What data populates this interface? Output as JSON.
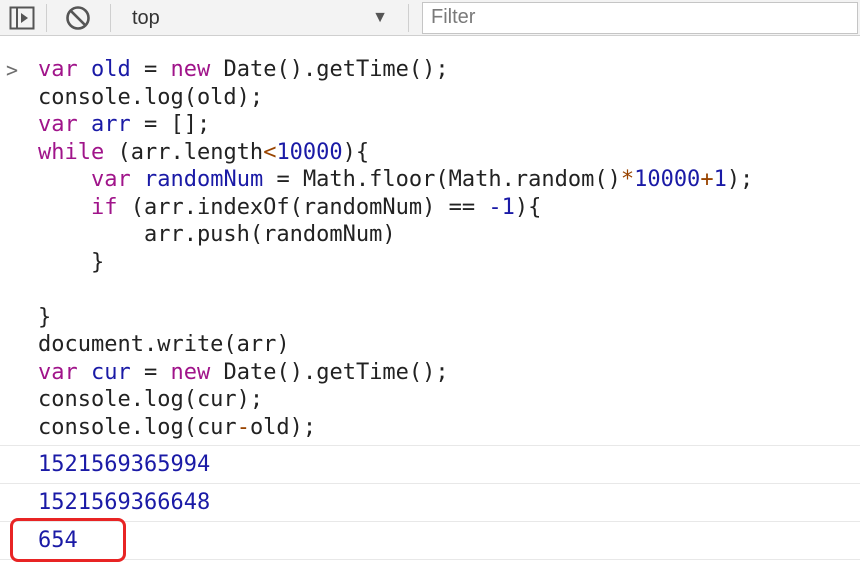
{
  "toolbar": {
    "context_value": "top",
    "filter_placeholder": "Filter",
    "icons": [
      "sidebar-toggle-icon",
      "clear-console-icon",
      "chevron-down-icon"
    ]
  },
  "console": {
    "prompt_symbol": ">",
    "code": {
      "l1": {
        "kw": "var",
        "var": "old",
        "eq": " = ",
        "kw2": "new",
        "rest": " Date().getTime();"
      },
      "l2": "console.log(old);",
      "l3": {
        "kw": "var",
        "var": "arr",
        "rest": " = [];"
      },
      "l4": {
        "kw": "while",
        "a": " (arr.length",
        "op": "<",
        "num": "10000",
        "b": "){"
      },
      "l5": {
        "indent": "    ",
        "kw": "var",
        "var": "randomNum",
        "a": " = Math.floor(Math.random()",
        "op": "*",
        "num": "10000",
        "op2": "+",
        "num2": "1",
        "b": ");"
      },
      "l6": {
        "indent": "    ",
        "kw": "if",
        "a": " (arr.indexOf(randomNum) == ",
        "num": "-1",
        "b": "){"
      },
      "l7": "        arr.push(randomNum)",
      "l8": "    }",
      "l9": "",
      "l10": "}",
      "l11": "document.write(arr)",
      "l12": {
        "kw": "var",
        "var": "cur",
        "eq": " = ",
        "kw2": "new",
        "rest": " Date().getTime();"
      },
      "l13": "console.log(cur);",
      "l14": {
        "a": "console.log(cur",
        "op": "-",
        "b": "old);"
      }
    },
    "outputs": [
      "1521569365994",
      "1521569366648",
      "654"
    ]
  },
  "colors": {
    "keyword": "#a0148a",
    "variable": "#1a1aa6",
    "operator": "#994400",
    "highlight": "#e82424"
  }
}
